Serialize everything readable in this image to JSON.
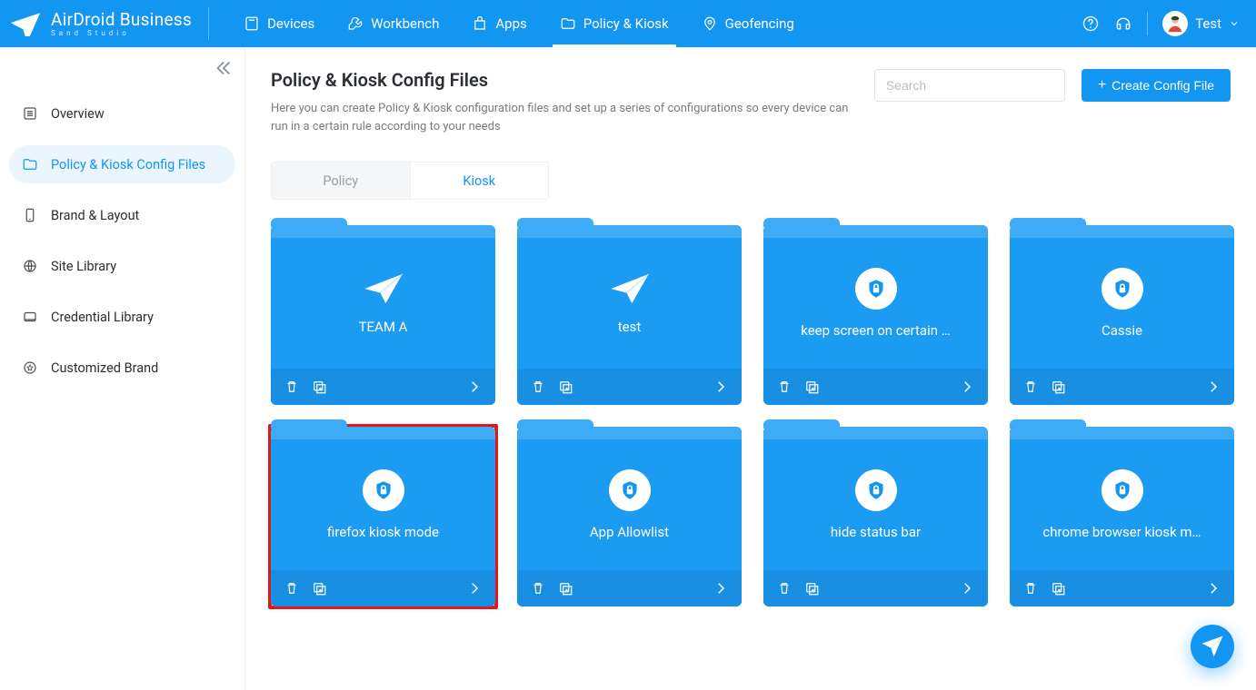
{
  "brand": {
    "name": "AirDroid Business",
    "subtitle": "Sand Studio"
  },
  "topnav": {
    "items": [
      {
        "label": "Devices"
      },
      {
        "label": "Workbench"
      },
      {
        "label": "Apps"
      },
      {
        "label": "Policy & Kiosk",
        "active": true
      },
      {
        "label": "Geofencing"
      }
    ]
  },
  "user": {
    "name": "Test"
  },
  "sidebar": {
    "items": [
      {
        "label": "Overview"
      },
      {
        "label": "Policy & Kiosk Config Files",
        "selected": true
      },
      {
        "label": "Brand & Layout"
      },
      {
        "label": "Site Library"
      },
      {
        "label": "Credential Library"
      },
      {
        "label": "Customized Brand"
      }
    ]
  },
  "page": {
    "title": "Policy & Kiosk Config Files",
    "subtitle": "Here you can create Policy & Kiosk configuration files and set up a series of configurations so every device can run in a certain rule according to your needs"
  },
  "search": {
    "placeholder": "Search",
    "value": ""
  },
  "create_button": {
    "label": "Create Config File"
  },
  "tabs": {
    "policy": "Policy",
    "kiosk": "Kiosk",
    "active": "kiosk"
  },
  "cards": [
    {
      "name": "TEAM A",
      "icon": "plane"
    },
    {
      "name": "test",
      "icon": "plane"
    },
    {
      "name": "keep screen on certain …",
      "icon": "lock"
    },
    {
      "name": "Cassie",
      "icon": "lock"
    },
    {
      "name": "firefox kiosk mode",
      "icon": "lock",
      "highlight": true
    },
    {
      "name": "App Allowlist",
      "icon": "lock"
    },
    {
      "name": "hide status bar",
      "icon": "lock"
    },
    {
      "name": "chrome browser kiosk m…",
      "icon": "lock"
    }
  ]
}
